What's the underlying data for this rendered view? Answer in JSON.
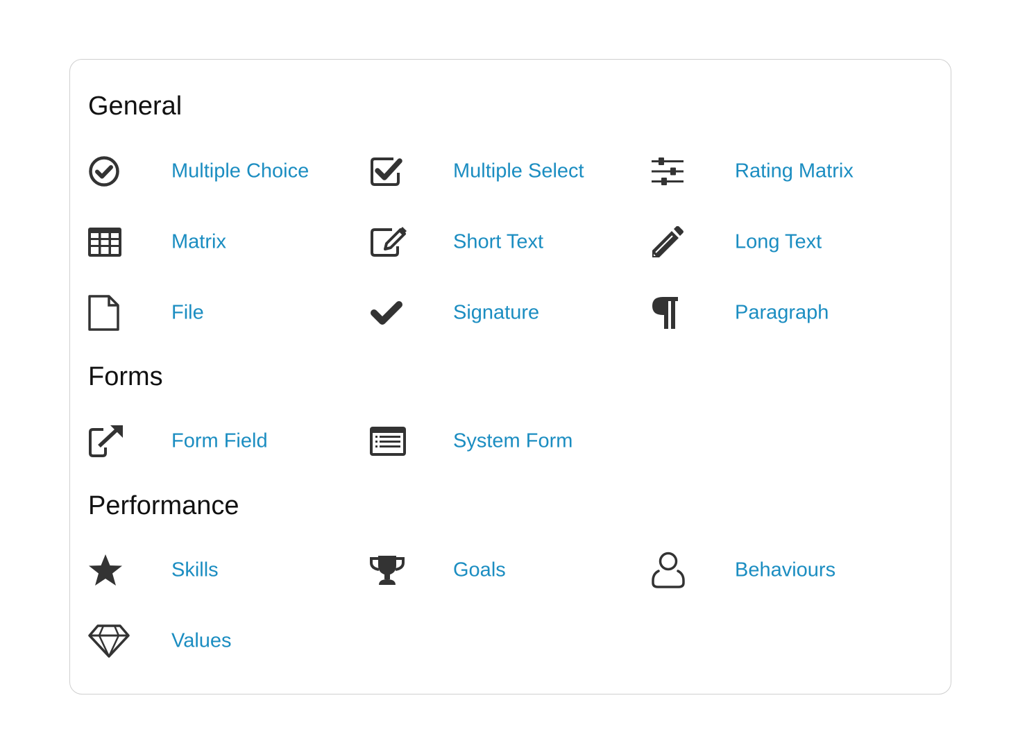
{
  "accent_color": "#1b8dc1",
  "icon_color": "#333333",
  "sections": [
    {
      "title": "General",
      "items": [
        {
          "label": "Multiple Choice",
          "icon": "check-circle-icon"
        },
        {
          "label": "Multiple Select",
          "icon": "check-square-icon"
        },
        {
          "label": "Rating Matrix",
          "icon": "sliders-icon"
        },
        {
          "label": "Matrix",
          "icon": "table-icon"
        },
        {
          "label": "Short Text",
          "icon": "edit-icon"
        },
        {
          "label": "Long Text",
          "icon": "pencil-icon"
        },
        {
          "label": "File",
          "icon": "file-icon"
        },
        {
          "label": "Signature",
          "icon": "check-icon"
        },
        {
          "label": "Paragraph",
          "icon": "paragraph-icon"
        }
      ]
    },
    {
      "title": "Forms",
      "items": [
        {
          "label": "Form Field",
          "icon": "external-link-icon"
        },
        {
          "label": "System Form",
          "icon": "list-alt-icon"
        }
      ]
    },
    {
      "title": "Performance",
      "items": [
        {
          "label": "Skills",
          "icon": "star-icon"
        },
        {
          "label": "Goals",
          "icon": "trophy-icon"
        },
        {
          "label": "Behaviours",
          "icon": "user-icon"
        },
        {
          "label": "Values",
          "icon": "diamond-icon"
        }
      ]
    }
  ]
}
